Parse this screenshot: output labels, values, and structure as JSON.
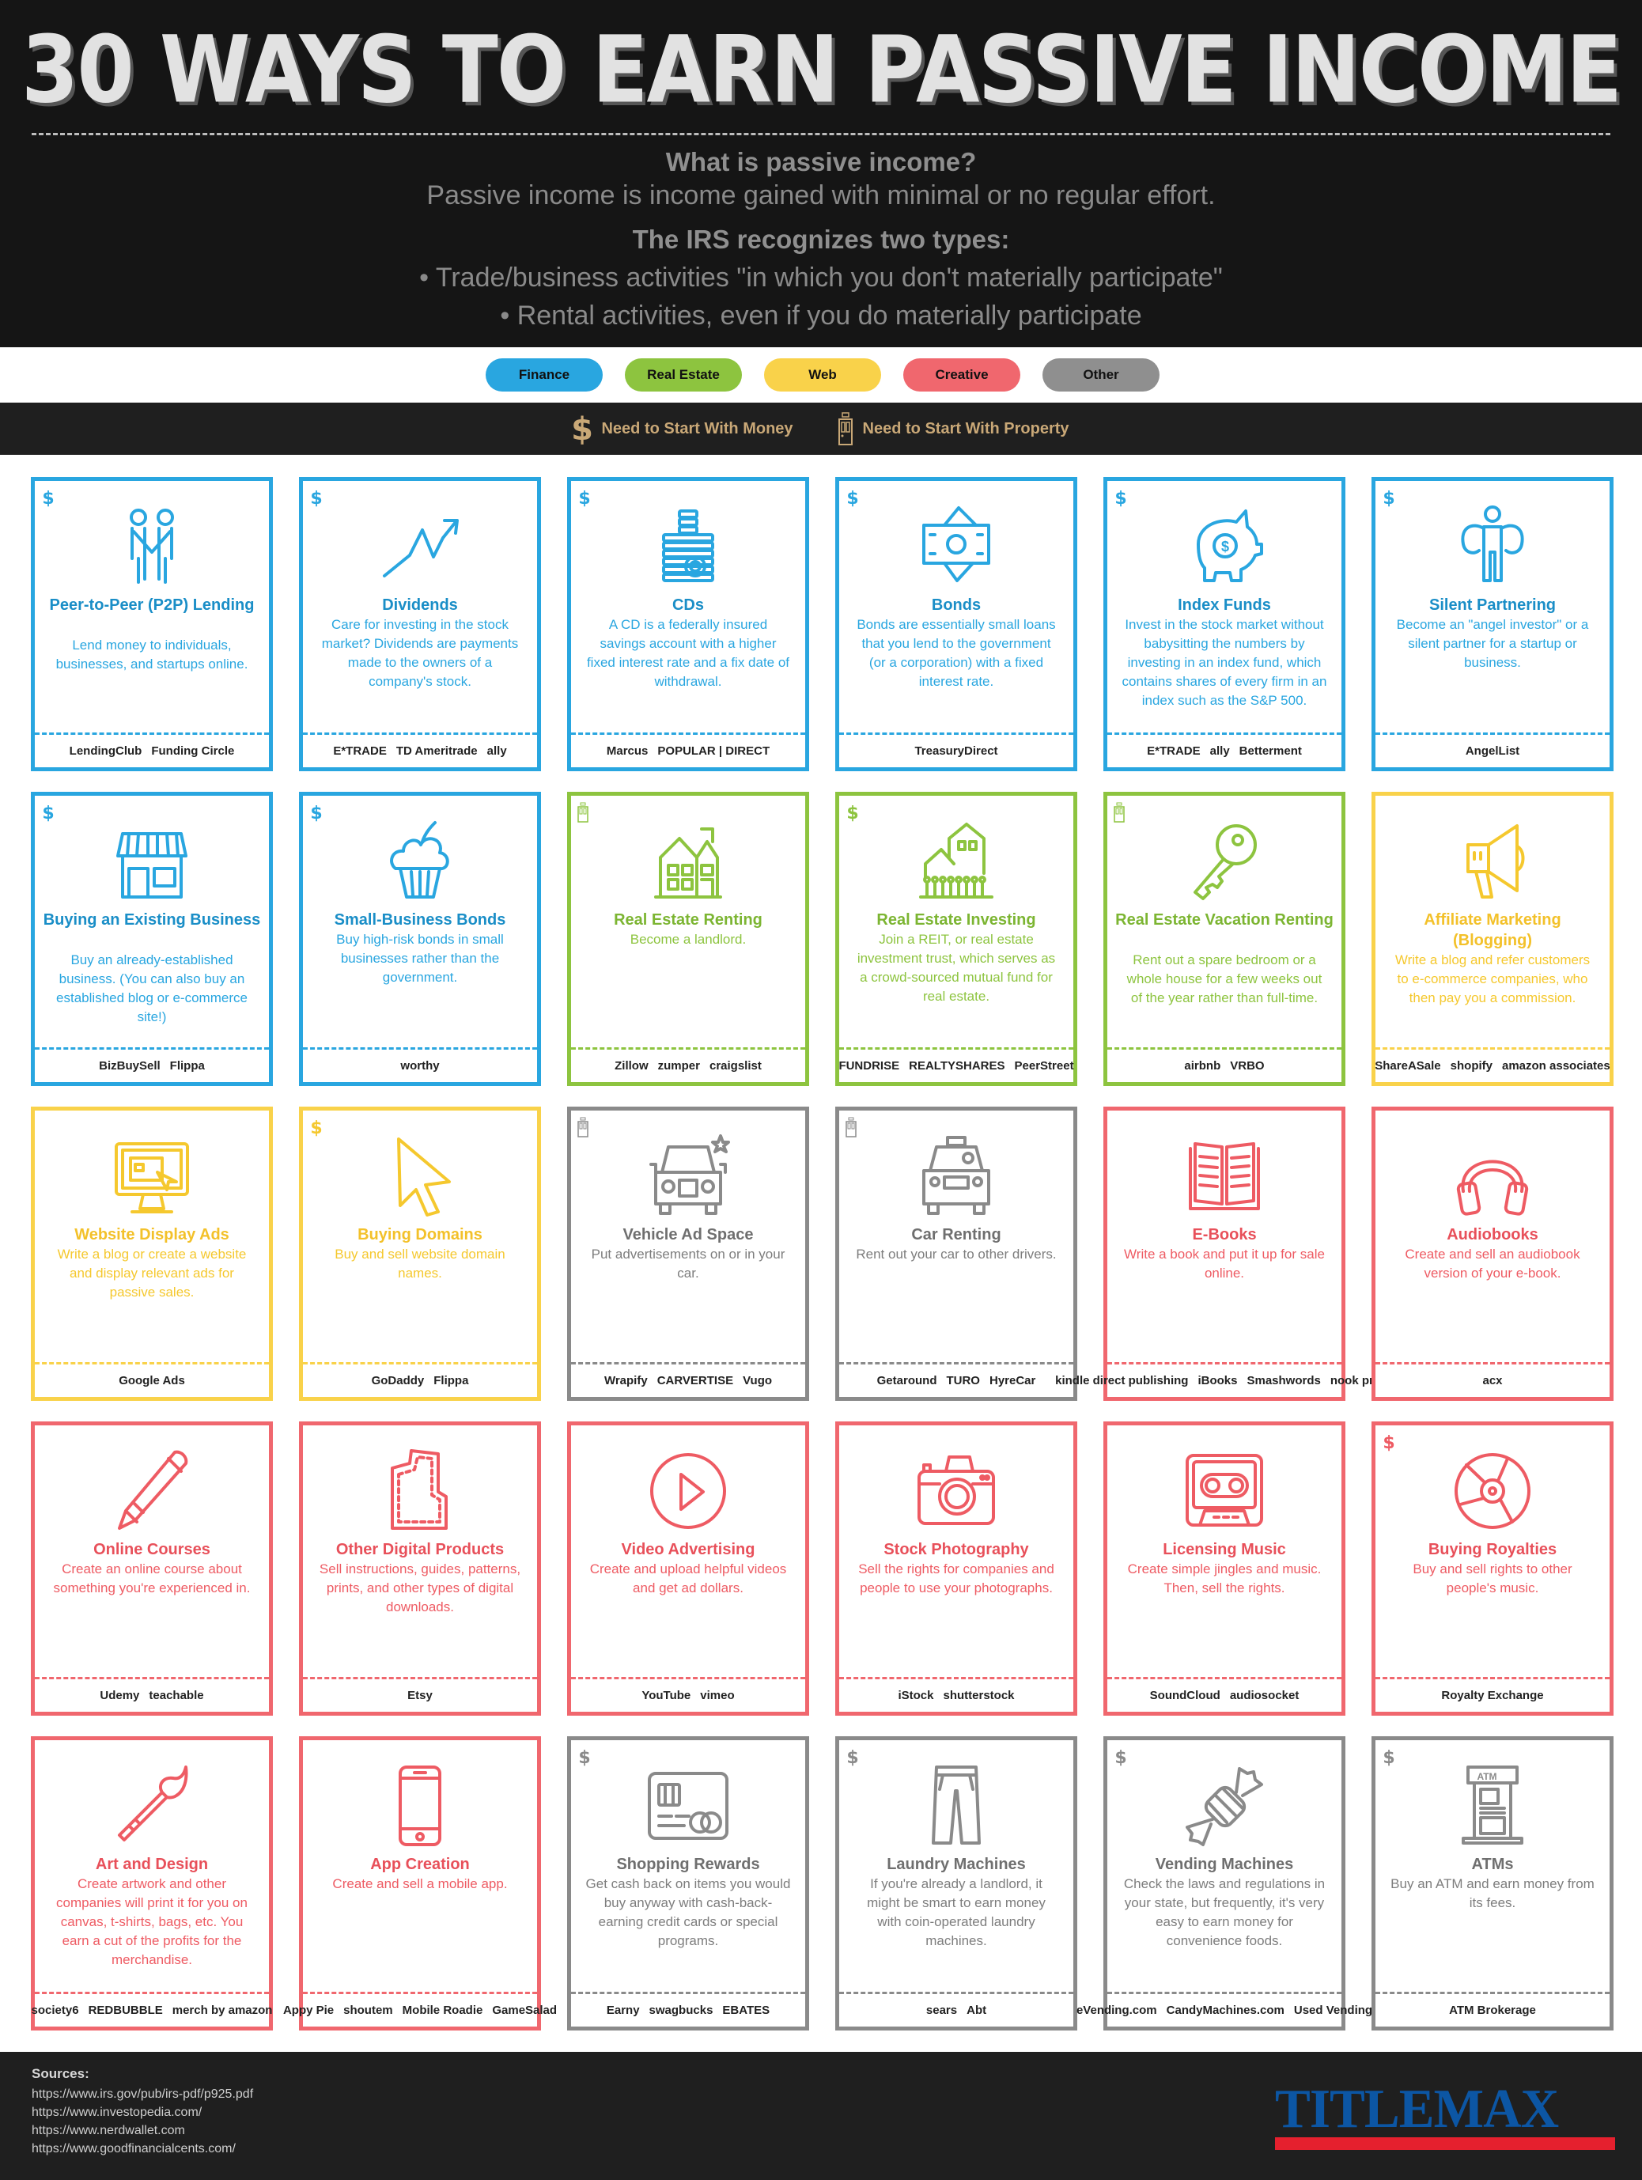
{
  "header": {
    "title": "30 WAYS TO EARN PASSIVE INCOME",
    "question": "What is passive income?",
    "definition": "Passive income is income gained with minimal or no regular effort.",
    "irs_heading": "The IRS recognizes two types:",
    "bullets": [
      "• Trade/business activities \"in which you don't materially participate\"",
      "• Rental activities, even if you do materially participate"
    ]
  },
  "legend": {
    "categories": [
      {
        "label": "Finance",
        "color": "#29a6e0"
      },
      {
        "label": "Real Estate",
        "color": "#8dc43f"
      },
      {
        "label": "Web",
        "color": "#f9d24a"
      },
      {
        "label": "Creative",
        "color": "#f0676e"
      },
      {
        "label": "Other",
        "color": "#8f8f8f"
      }
    ],
    "requirements": [
      {
        "label": "Need to Start With Money",
        "icon": "dollar-icon"
      },
      {
        "label": "Need to Start With Property",
        "icon": "door-icon"
      }
    ],
    "requirement_color": "#c9a877"
  },
  "cards": [
    {
      "title": "Peer-to-Peer (P2P) Lending",
      "desc": "Lend money to individuals, businesses, and startups online.",
      "category": "fin",
      "req": "money",
      "icon": "handshake-icon",
      "logos": [
        "LendingClub",
        "Funding Circle"
      ]
    },
    {
      "title": "Dividends",
      "desc": "Care for investing in the stock market? Dividends are payments made to the owners of a company's stock.",
      "category": "fin",
      "req": "money",
      "icon": "trend-arrow-icon",
      "logos": [
        "E*TRADE",
        "TD Ameritrade",
        "ally"
      ]
    },
    {
      "title": "CDs",
      "desc": "A CD is a federally insured savings account with a higher fixed interest rate and a fix date of withdrawal.",
      "category": "fin",
      "req": "money",
      "icon": "coin-stack-icon",
      "logos": [
        "Marcus",
        "POPULAR | DIRECT"
      ]
    },
    {
      "title": "Bonds",
      "desc": "Bonds are essentially small loans that you lend to the government (or a corporation) with a fixed interest rate.",
      "category": "fin",
      "req": "money",
      "icon": "banknotes-icon",
      "logos": [
        "TreasuryDirect"
      ]
    },
    {
      "title": "Index Funds",
      "desc": "Invest in the stock market without babysitting the numbers by investing in an index fund, which contains shares of every firm in an index such as the S&P 500.",
      "category": "fin",
      "req": "money",
      "icon": "piggy-bank-icon",
      "logos": [
        "E*TRADE",
        "ally",
        "Betterment"
      ]
    },
    {
      "title": "Silent Partnering",
      "desc": "Become an \"angel investor\" or a silent partner for a startup or business.",
      "category": "fin",
      "req": "money",
      "icon": "angel-investor-icon",
      "logos": [
        "AngelList"
      ]
    },
    {
      "title": "Buying an Existing Business",
      "desc": "Buy an already-established business. (You can also buy an established blog or e-commerce site!)",
      "category": "fin",
      "req": "money",
      "icon": "storefront-icon",
      "logos": [
        "BizBuySell",
        "Flippa"
      ]
    },
    {
      "title": "Small-Business Bonds",
      "desc": "Buy high-risk bonds in small businesses rather than the government.",
      "category": "fin",
      "req": "money",
      "icon": "cupcake-icon",
      "logos": [
        "worthy"
      ]
    },
    {
      "title": "Real Estate Renting",
      "desc": "Become a landlord.",
      "category": "re",
      "req": "property",
      "icon": "house-icon",
      "logos": [
        "Zillow",
        "zumper",
        "craigslist"
      ]
    },
    {
      "title": "Real Estate Investing",
      "desc": "Join a REIT, or real estate investment trust, which serves as a crowd-sourced mutual fund for real estate.",
      "category": "re",
      "req": "money",
      "icon": "houses-crowd-icon",
      "logos": [
        "FUNDRISE",
        "REALTYSHARES",
        "PeerStreet"
      ]
    },
    {
      "title": "Real Estate Vacation Renting",
      "desc": "Rent out a spare bedroom or a whole house for a few weeks out of the year rather than full-time.",
      "category": "re",
      "req": "property",
      "icon": "key-icon",
      "logos": [
        "airbnb",
        "VRBO"
      ]
    },
    {
      "title": "Affiliate Marketing (Blogging)",
      "desc": "Write a blog and refer customers to e-commerce companies, who then pay you a commission.",
      "category": "web",
      "req": "",
      "icon": "megaphone-icon",
      "logos": [
        "ShareASale",
        "shopify",
        "amazon associates"
      ]
    },
    {
      "title": "Website Display Ads",
      "desc": "Write a blog or create a website and display relevant ads for passive sales.",
      "category": "web",
      "req": "",
      "icon": "monitor-icon",
      "logos": [
        "Google Ads"
      ]
    },
    {
      "title": "Buying Domains",
      "desc": "Buy and sell website domain names.",
      "category": "web",
      "req": "money",
      "icon": "cursor-icon",
      "logos": [
        "GoDaddy",
        "Flippa"
      ]
    },
    {
      "title": "Vehicle Ad Space",
      "desc": "Put advertisements on or in your car.",
      "category": "oth",
      "req": "property",
      "icon": "car-star-icon",
      "logos": [
        "Wrapify",
        "CARVERTISE",
        "Vugo"
      ]
    },
    {
      "title": "Car Renting",
      "desc": "Rent out your car to other drivers.",
      "category": "oth",
      "req": "property",
      "icon": "taxi-icon",
      "logos": [
        "Getaround",
        "TURO",
        "HyreCar"
      ]
    },
    {
      "title": "E-Books",
      "desc": "Write a book and put it up for sale online.",
      "category": "cre",
      "req": "",
      "icon": "open-book-icon",
      "logos": [
        "kindle direct publishing",
        "iBooks",
        "Smashwords",
        "nook press"
      ]
    },
    {
      "title": "Audiobooks",
      "desc": "Create and sell an audiobook version of your e-book.",
      "category": "cre",
      "req": "",
      "icon": "headphones-icon",
      "logos": [
        "acx"
      ]
    },
    {
      "title": "Online Courses",
      "desc": "Create an online course about something you're experienced in.",
      "category": "cre",
      "req": "",
      "icon": "pencil-icon",
      "logos": [
        "Udemy",
        "teachable"
      ]
    },
    {
      "title": "Other Digital Products",
      "desc": "Sell instructions, guides, patterns, prints, and other types of digital downloads.",
      "category": "cre",
      "req": "",
      "icon": "sewing-pattern-icon",
      "logos": [
        "Etsy"
      ]
    },
    {
      "title": "Video Advertising",
      "desc": "Create and upload helpful videos and get ad dollars.",
      "category": "cre",
      "req": "",
      "icon": "play-button-icon",
      "logos": [
        "YouTube",
        "vimeo"
      ]
    },
    {
      "title": "Stock Photography",
      "desc": "Sell the rights for companies and people to use your photographs.",
      "category": "cre",
      "req": "",
      "icon": "camera-icon",
      "logos": [
        "iStock",
        "shutterstock"
      ]
    },
    {
      "title": "Licensing Music",
      "desc": "Create simple jingles and music. Then, sell the rights.",
      "category": "cre",
      "req": "",
      "icon": "cassette-icon",
      "logos": [
        "SoundCloud",
        "audiosocket"
      ]
    },
    {
      "title": "Buying Royalties",
      "desc": "Buy and sell rights to other people's music.",
      "category": "cre",
      "req": "money",
      "icon": "disc-icon",
      "logos": [
        "Royalty Exchange"
      ]
    },
    {
      "title": "Art and Design",
      "desc": "Create artwork and other companies will print it for you on canvas, t-shirts, bags, etc. You earn a cut of the profits for the merchandise.",
      "category": "cre",
      "req": "",
      "icon": "paintbrush-icon",
      "logos": [
        "society6",
        "REDBUBBLE",
        "merch by amazon"
      ]
    },
    {
      "title": "App Creation",
      "desc": "Create and sell a mobile app.",
      "category": "cre",
      "req": "",
      "icon": "smartphone-icon",
      "logos": [
        "Appy Pie",
        "shoutem",
        "Mobile Roadie",
        "GameSalad"
      ]
    },
    {
      "title": "Shopping Rewards",
      "desc": "Get cash back on items you would buy anyway with cash-back-earning credit cards or special programs.",
      "category": "oth",
      "req": "money",
      "icon": "credit-card-icon",
      "logos": [
        "Earny",
        "swagbucks",
        "EBATES"
      ]
    },
    {
      "title": "Laundry Machines",
      "desc": "If you're already a landlord, it might be smart to earn money with coin-operated laundry machines.",
      "category": "oth",
      "req": "money",
      "icon": "pants-icon",
      "logos": [
        "sears",
        "Abt"
      ]
    },
    {
      "title": "Vending Machines",
      "desc": "Check the laws and regulations in your state, but frequently, it's very easy to earn money for convenience foods.",
      "category": "oth",
      "req": "money",
      "icon": "candy-icon",
      "logos": [
        "eVending.com",
        "CandyMachines.com",
        "Used Vending"
      ]
    },
    {
      "title": "ATMs",
      "desc": "Buy an ATM and earn money from its fees.",
      "category": "oth",
      "req": "money",
      "icon": "atm-icon",
      "logos": [
        "ATM Brokerage"
      ]
    }
  ],
  "footer": {
    "sources_label": "Sources:",
    "sources": [
      "https://www.irs.gov/pub/irs-pdf/p925.pdf",
      "https://www.investopedia.com/",
      "https://www.nerdwallet.com",
      "https://www.goodfinancialcents.com/"
    ],
    "brand": "TITLEMAX",
    "brand_colors": {
      "text": "#0c56a4",
      "bar": "#e5202e"
    }
  }
}
